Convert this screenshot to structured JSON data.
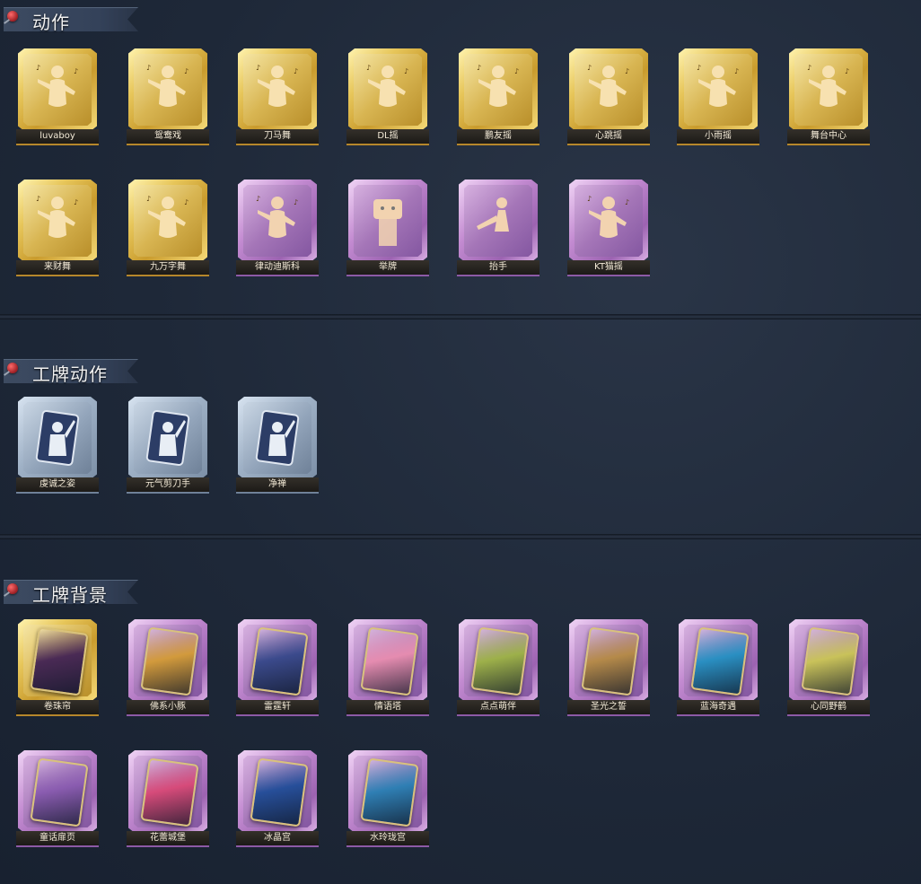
{
  "sections": [
    {
      "title": "动作",
      "items": [
        {
          "label": "luvaboy",
          "rarity": "gold",
          "icon": "dance-pose-icon"
        },
        {
          "label": "鸳鸯戏",
          "rarity": "gold",
          "icon": "dance-pose-icon"
        },
        {
          "label": "刀马舞",
          "rarity": "gold",
          "icon": "dance-pose-icon"
        },
        {
          "label": "DL摇",
          "rarity": "gold",
          "icon": "dance-pose-icon"
        },
        {
          "label": "鹏友摇",
          "rarity": "gold",
          "icon": "dance-pose-icon"
        },
        {
          "label": "心跳摇",
          "rarity": "gold",
          "icon": "dance-pose-icon"
        },
        {
          "label": "小雨摇",
          "rarity": "gold",
          "icon": "dance-pose-icon"
        },
        {
          "label": "舞台中心",
          "rarity": "gold",
          "icon": "dance-pose-icon"
        },
        {
          "label": "来财舞",
          "rarity": "gold",
          "icon": "dance-pose-icon"
        },
        {
          "label": "九万字舞",
          "rarity": "gold",
          "icon": "dance-pose-icon"
        },
        {
          "label": "律动迪斯科",
          "rarity": "purple",
          "icon": "dance-pose-icon"
        },
        {
          "label": "举牌",
          "rarity": "purple",
          "icon": "sign-holding-icon"
        },
        {
          "label": "抬手",
          "rarity": "purple",
          "icon": "raise-hand-icon"
        },
        {
          "label": "KT猫摇",
          "rarity": "purple",
          "icon": "dance-pose-icon"
        }
      ]
    },
    {
      "title": "工牌动作",
      "items": [
        {
          "label": "虔诚之姿",
          "rarity": "blue",
          "icon": "badge-pose-icon"
        },
        {
          "label": "元气剪刀手",
          "rarity": "blue",
          "icon": "badge-pose-icon"
        },
        {
          "label": "净禅",
          "rarity": "blue",
          "icon": "badge-pose-icon"
        }
      ]
    },
    {
      "title": "工牌背景",
      "items": [
        {
          "label": "卷珠帘",
          "rarity": "gold",
          "icon": "badge-background-icon",
          "art": "#4a2a55"
        },
        {
          "label": "佛系小豚",
          "rarity": "purple",
          "icon": "badge-background-icon",
          "art": "#d29a3c"
        },
        {
          "label": "雷霆轩",
          "rarity": "purple",
          "icon": "badge-background-icon",
          "art": "#3b4a8c"
        },
        {
          "label": "情语塔",
          "rarity": "purple",
          "icon": "badge-background-icon",
          "art": "#e58cb0"
        },
        {
          "label": "点点萌伴",
          "rarity": "purple",
          "icon": "badge-background-icon",
          "art": "#9db04a"
        },
        {
          "label": "圣光之誓",
          "rarity": "purple",
          "icon": "badge-background-icon",
          "art": "#b58a4a"
        },
        {
          "label": "蓝海奇遇",
          "rarity": "purple",
          "icon": "badge-background-icon",
          "art": "#2a8fc2"
        },
        {
          "label": "心同野鹤",
          "rarity": "purple",
          "icon": "badge-background-icon",
          "art": "#c9c25a"
        },
        {
          "label": "童话扉页",
          "rarity": "purple",
          "icon": "badge-background-icon",
          "art": "#8a5cb0"
        },
        {
          "label": "花蕾城堡",
          "rarity": "purple",
          "icon": "badge-background-icon",
          "art": "#d64b7a"
        },
        {
          "label": "冰晶宫",
          "rarity": "purple",
          "icon": "badge-background-icon",
          "art": "#274f9a"
        },
        {
          "label": "水玲珑宫",
          "rarity": "purple",
          "icon": "badge-background-icon",
          "art": "#2f7fb4"
        }
      ]
    }
  ]
}
